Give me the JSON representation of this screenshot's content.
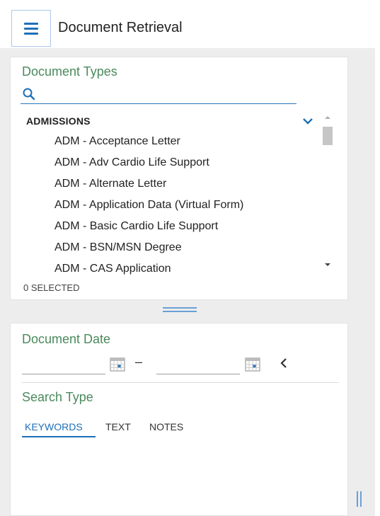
{
  "header": {
    "title": "Document Retrieval",
    "menu_icon": "hamburger-menu-icon"
  },
  "document_types": {
    "heading": "Document Types",
    "search_placeholder": "",
    "group": "ADMISSIONS",
    "items": [
      "ADM - Acceptance Letter",
      "ADM - Adv Cardio Life Support",
      "ADM - Alternate Letter",
      "ADM - Application Data (Virtual Form)",
      "ADM - Basic Cardio Life Support",
      "ADM - BSN/MSN Degree",
      "ADM - CAS Application"
    ],
    "selected_count": "0 SELECTED"
  },
  "document_date": {
    "heading": "Document Date",
    "from_value": "",
    "to_value": "",
    "separator": "–"
  },
  "search_type": {
    "heading": "Search Type",
    "tabs": [
      "KEYWORDS",
      "TEXT",
      "NOTES"
    ],
    "active_tab": "KEYWORDS"
  },
  "colors": {
    "accent": "#1e6fb8",
    "heading_green": "#4a8a5c",
    "workspace_gray": "#ededed"
  }
}
